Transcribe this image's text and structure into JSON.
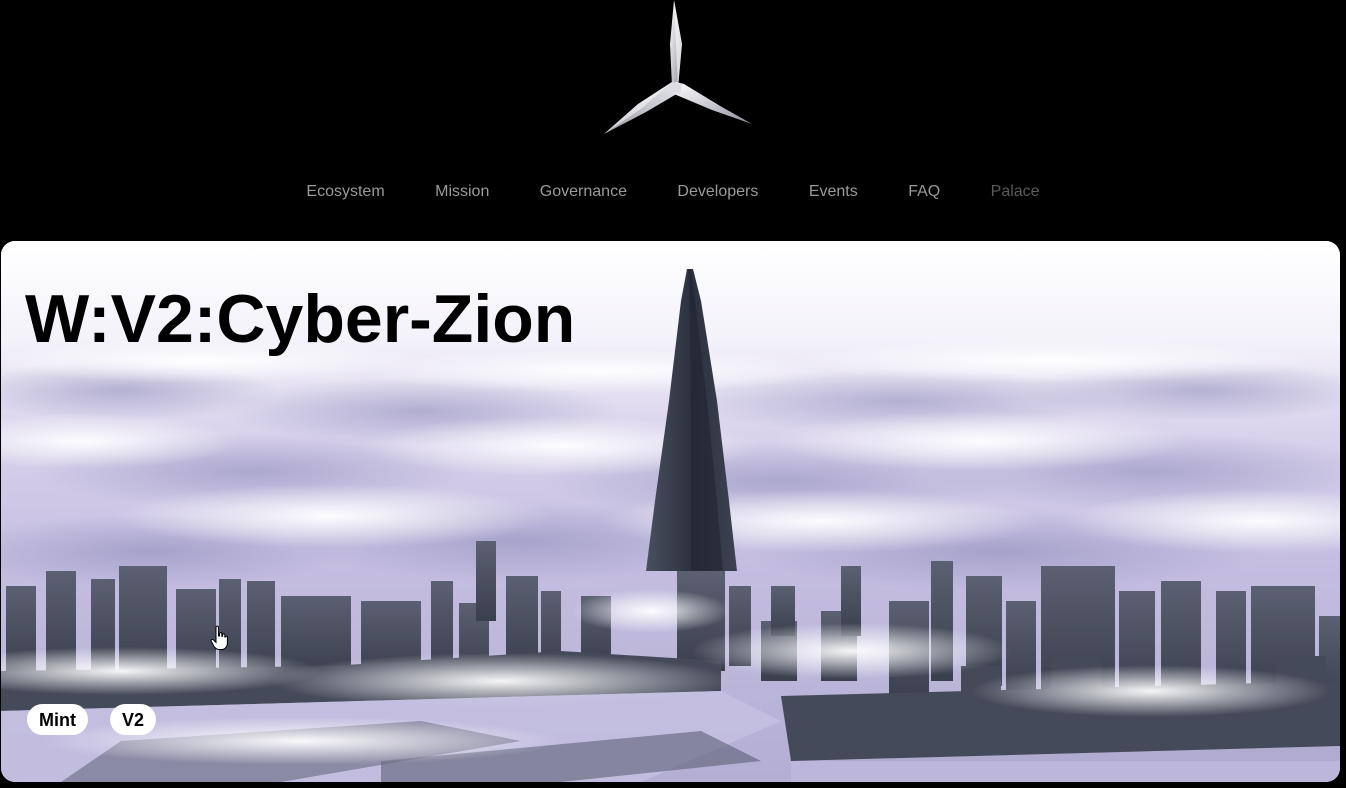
{
  "nav": {
    "items": [
      {
        "label": "Ecosystem"
      },
      {
        "label": "Mission"
      },
      {
        "label": "Governance"
      },
      {
        "label": "Developers"
      },
      {
        "label": "Events"
      },
      {
        "label": "FAQ"
      },
      {
        "label": "Palace"
      }
    ]
  },
  "hero": {
    "title": "W:V2:Cyber-Zion",
    "tags": [
      {
        "label": "Mint"
      },
      {
        "label": "V2"
      }
    ],
    "image_description_icon": "city-above-clouds-image"
  },
  "icons": {
    "logo": "tri-blade-logo-icon",
    "cursor": "hand-pointer-icon"
  },
  "colors": {
    "background": "#000000",
    "nav_text": "#9a9a9a",
    "nav_text_dim": "#5a5a5a",
    "title_text": "#000000",
    "tag_bg": "#ffffff"
  }
}
